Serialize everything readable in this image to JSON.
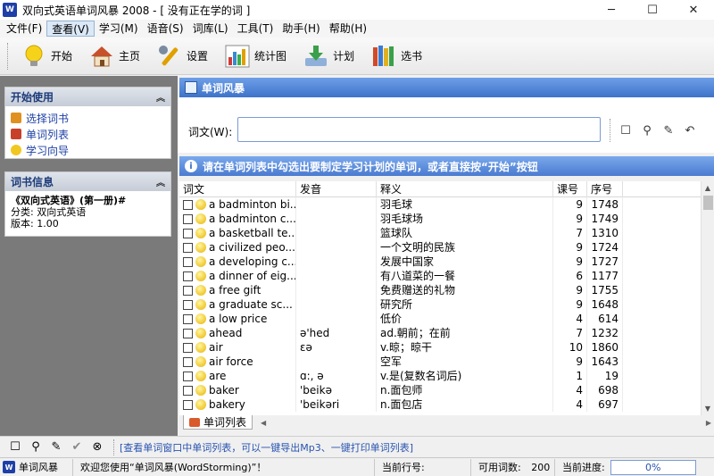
{
  "window": {
    "title": "双向式英语单词风暴 2008 - [ 没有正在学的词 ]",
    "app_icon": "W",
    "minimize": "─",
    "maximize": "☐",
    "close": "✕"
  },
  "menu": [
    {
      "label": "文件(F)",
      "active": false
    },
    {
      "label": "查看(V)",
      "active": true
    },
    {
      "label": "学习(M)",
      "active": false
    },
    {
      "label": "语音(S)",
      "active": false
    },
    {
      "label": "词库(L)",
      "active": false
    },
    {
      "label": "工具(T)",
      "active": false
    },
    {
      "label": "助手(H)",
      "active": false
    },
    {
      "label": "帮助(H)",
      "active": false
    }
  ],
  "toolbar": [
    {
      "label": "开始",
      "icon": "lightbulb-icon",
      "color": "#f7d21a"
    },
    {
      "label": "主页",
      "icon": "house-icon",
      "color": "#c8502a"
    },
    {
      "label": "设置",
      "icon": "wrench-icon",
      "color": "#e0a000"
    },
    {
      "label": "统计图",
      "icon": "bar-chart-icon",
      "color": "#5b8fd6"
    },
    {
      "label": "计划",
      "icon": "download-icon",
      "color": "#3aa04a"
    },
    {
      "label": "选书",
      "icon": "books-icon",
      "color": "#d04a2a"
    }
  ],
  "left_panel": {
    "start": {
      "title": "开始使用",
      "links": [
        {
          "label": "选择词书",
          "icon": "book-icon",
          "color": "#e09020"
        },
        {
          "label": "单词列表",
          "icon": "list-icon",
          "color": "#c8402a"
        },
        {
          "label": "学习向导",
          "icon": "bulb-icon",
          "color": "#f0c820"
        }
      ]
    },
    "book_info": {
      "title": "词书信息",
      "book_name": "《双向式英语》(第一册)#",
      "category": "分类: 双向式英语",
      "version": "版本: 1.00"
    },
    "collapse": "︽"
  },
  "main": {
    "header": "单词风暴",
    "word_label": "词文(W):",
    "word_value": "",
    "hint": "请在单词列表中勾选出要制定学习计划的单词，或者直接按“开始”按钮",
    "columns": [
      "词文",
      "发音",
      "释义",
      "课号",
      "序号"
    ],
    "rows": [
      {
        "word": "a badminton bi...",
        "phonetic": "",
        "definition": "羽毛球",
        "lesson": "9",
        "seq": "1748"
      },
      {
        "word": "a badminton c...",
        "phonetic": "",
        "definition": "羽毛球场",
        "lesson": "9",
        "seq": "1749"
      },
      {
        "word": "a basketball te...",
        "phonetic": "",
        "definition": "篮球队",
        "lesson": "7",
        "seq": "1310"
      },
      {
        "word": "a civilized peo...",
        "phonetic": "",
        "definition": "一个文明的民族",
        "lesson": "9",
        "seq": "1724"
      },
      {
        "word": "a developing c...",
        "phonetic": "",
        "definition": "发展中国家",
        "lesson": "9",
        "seq": "1727"
      },
      {
        "word": "a dinner of eig...",
        "phonetic": "",
        "definition": "有八道菜的一餐",
        "lesson": "6",
        "seq": "1177"
      },
      {
        "word": "a free gift",
        "phonetic": "",
        "definition": "免费赠送的礼物",
        "lesson": "9",
        "seq": "1755"
      },
      {
        "word": "a graduate sc...",
        "phonetic": "",
        "definition": "研究所",
        "lesson": "9",
        "seq": "1648"
      },
      {
        "word": "a low price",
        "phonetic": "",
        "definition": "低价",
        "lesson": "4",
        "seq": "614"
      },
      {
        "word": "ahead",
        "phonetic": "ə'hed",
        "definition": "ad.朝前；在前",
        "lesson": "7",
        "seq": "1232"
      },
      {
        "word": "air",
        "phonetic": "εə",
        "definition": "v.晾；晾干",
        "lesson": "10",
        "seq": "1860"
      },
      {
        "word": "air force",
        "phonetic": "",
        "definition": "空军",
        "lesson": "9",
        "seq": "1643"
      },
      {
        "word": "are",
        "phonetic": "ɑ:, ə",
        "definition": "v.是(复数名词后)",
        "lesson": "1",
        "seq": "19"
      },
      {
        "word": "baker",
        "phonetic": "'beikə",
        "definition": "n.面包师",
        "lesson": "4",
        "seq": "698"
      },
      {
        "word": "bakery",
        "phonetic": "'beikəri",
        "definition": "n.面包店",
        "lesson": "4",
        "seq": "697"
      }
    ],
    "sheet_tab": "单词列表"
  },
  "bottom_bar": {
    "hint": "[查看单词窗口中单词列表，可以一键导出Mp3、一键打印单词列表]"
  },
  "status": {
    "app_name": "单词风暴",
    "welcome": "欢迎您使用“单词风暴(WordStorming)”！",
    "current_row_label": "当前行号:",
    "current_row_value": "",
    "available_label": "可用词数:",
    "available_value": "200",
    "progress_label": "当前进度:",
    "progress_value": "0%",
    "progress_fraction": 0
  }
}
